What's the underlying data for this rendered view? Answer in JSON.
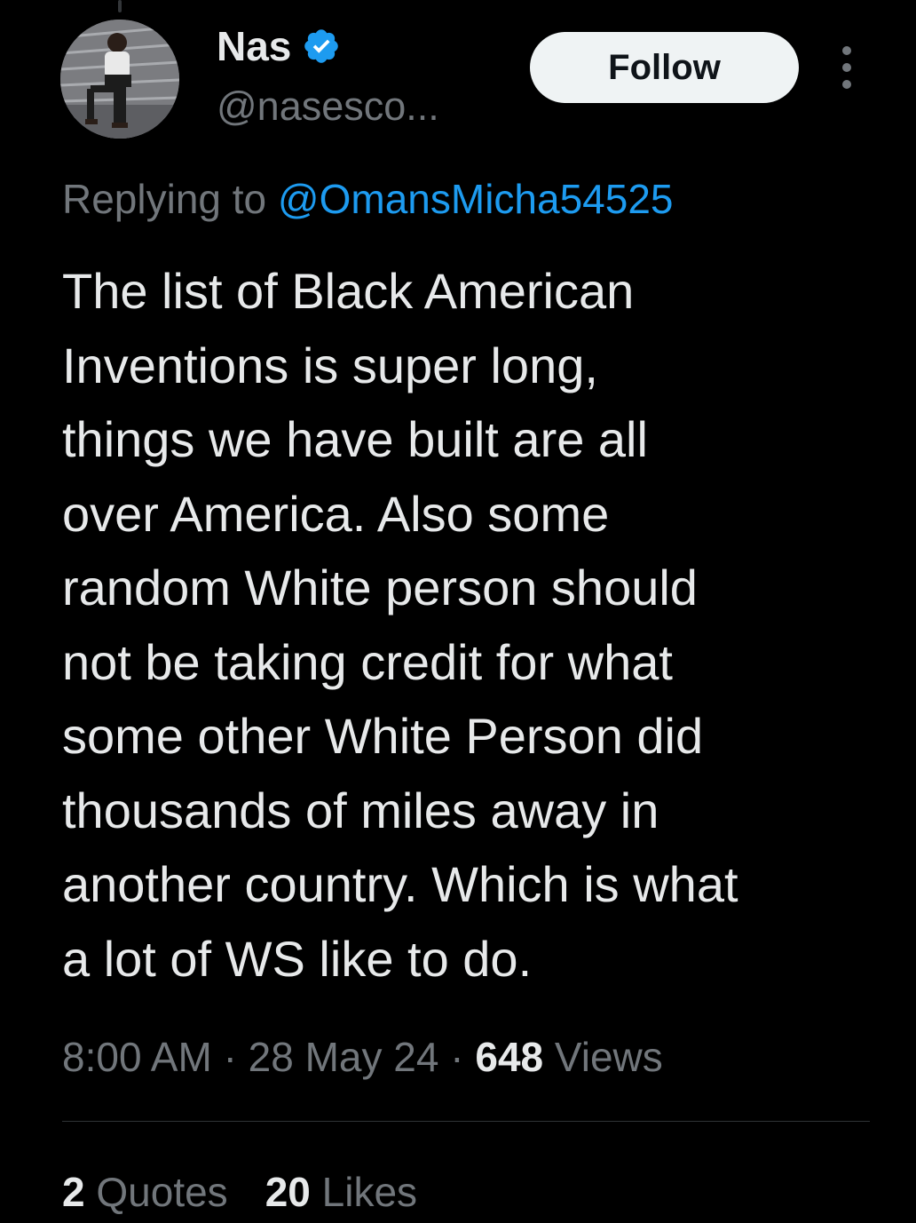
{
  "author": {
    "display_name": "Nas",
    "handle": "@nasesco...",
    "verified": true,
    "avatar_icon": "profile-photo"
  },
  "actions": {
    "follow_label": "Follow",
    "more_icon": "more-options-icon"
  },
  "reply": {
    "prefix": "Replying to",
    "mention": "@OmansMicha54525"
  },
  "tweet": {
    "text": "The list of Black American\nInventions is super long,\nthings we have built are all\nover America. Also some\nrandom White person should\nnot be taking credit for what\nsome other White Person did\nthousands of miles away in\nanother country. Which is what\na lot of WS like to do."
  },
  "meta": {
    "time": "8:00 AM",
    "separator": "·",
    "date": "28 May 24",
    "views_count": "648",
    "views_label": "Views"
  },
  "stats": {
    "quotes_count": "2",
    "quotes_label": "Quotes",
    "likes_count": "20",
    "likes_label": "Likes"
  },
  "colors": {
    "background": "#000000",
    "accent": "#1d9bf0",
    "primary_text": "#e7e9ea",
    "secondary_text": "#71767b"
  }
}
